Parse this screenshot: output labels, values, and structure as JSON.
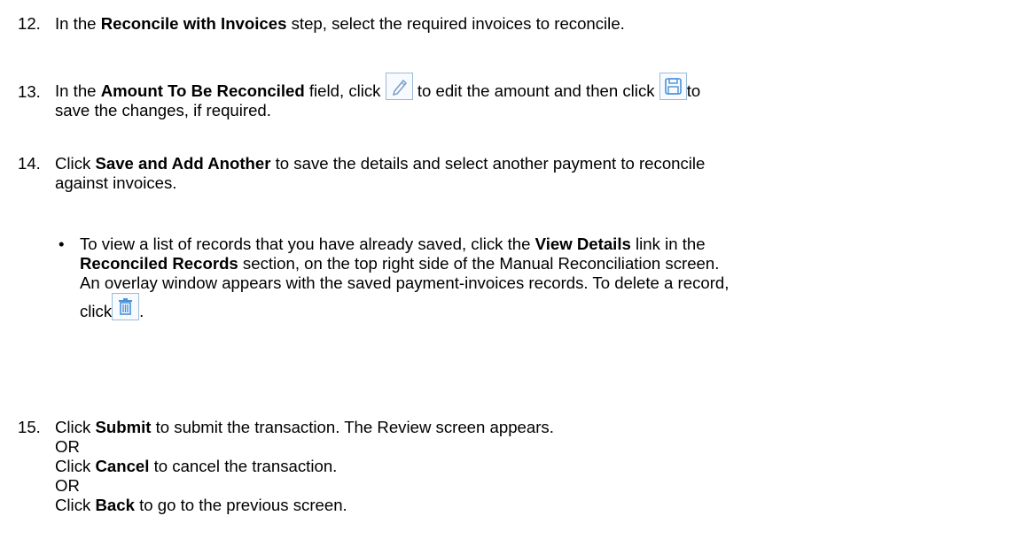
{
  "steps": [
    {
      "number": "12.",
      "pre": "In the ",
      "bold": "Reconcile with Invoices",
      "post": " step, select the required invoices to reconcile."
    },
    {
      "number": "13.",
      "pre": "In the ",
      "bold": "Amount To Be Reconciled",
      "mid1": " field, click ",
      "edit_icon": "pencil-edit-icon",
      "mid2": " to edit the amount and then click ",
      "save_icon": "floppy-save-icon",
      "tail": "to",
      "line2": "save the changes, if required."
    },
    {
      "number": "14.",
      "pre": "Click ",
      "bold": "Save and Add Another",
      "post": " to save the details and select another payment to reconcile",
      "line2": "against invoices.",
      "bullet": {
        "symbol": "•",
        "l1_pre": "To view a list of records that you have already saved, click the ",
        "l1_bold": "View Details",
        "l1_post": " link in the",
        "l2_bold": "Reconciled Records",
        "l2_post": " section, on the top right side of the Manual Reconciliation screen.",
        "l3": "An overlay window appears with the saved payment-invoices records. To delete a record,",
        "l4_pre": "click",
        "delete_icon": "trash-delete-icon",
        "l4_post": "."
      }
    },
    {
      "number": "15.",
      "pre": "Click ",
      "bold": "Submit",
      "post": " to submit the transaction. The Review screen appears.",
      "or1": "OR",
      "c_pre": "Click ",
      "c_bold": "Cancel",
      "c_post": " to cancel the transaction.",
      "or2": "OR",
      "b_pre": "Click ",
      "b_bold": "Back",
      "b_post": " to go to the previous screen."
    }
  ],
  "colors": {
    "icon_border": "#9dbbd6",
    "icon_blue": "#4a90d9"
  }
}
